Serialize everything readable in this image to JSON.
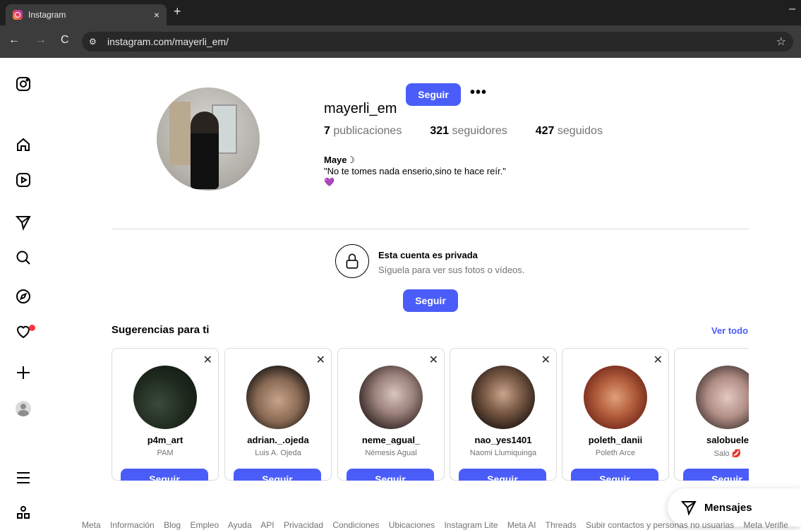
{
  "browser": {
    "tab_title": "Instagram",
    "tab_close": "×",
    "new_tab": "+",
    "minimize": "–",
    "back": "←",
    "forward": "→",
    "reload": "C",
    "url": "instagram.com/mayerli_em/"
  },
  "profile": {
    "username": "mayerli_em",
    "follow_label": "Seguir",
    "more": "•••",
    "posts_count": "7",
    "posts_label": "publicaciones",
    "followers_count": "321",
    "followers_label": "seguidores",
    "following_count": "427",
    "following_label": "seguidos",
    "bio_name": "Maye☽",
    "bio_text": "\"No te tomes nada enserio,sino te hace reír.\"",
    "bio_emoji": "💜"
  },
  "private": {
    "title": "Esta cuenta es privada",
    "subtitle": "Síguela para ver sus fotos o vídeos.",
    "follow_label": "Seguir"
  },
  "suggestions": {
    "title": "Sugerencias para ti",
    "see_all": "Ver todo",
    "close": "✕",
    "items": [
      {
        "username": "p4m_art",
        "name": "PAM",
        "button": "Seguir"
      },
      {
        "username": "adrian._.ojeda",
        "name": "Luis A. Ojeda",
        "button": "Seguir"
      },
      {
        "username": "neme_agual_",
        "name": "Némesis Agual",
        "button": "Seguir"
      },
      {
        "username": "nao_yes1401",
        "name": "Naomi Llumiquinga",
        "button": "Seguir"
      },
      {
        "username": "poleth_danii",
        "name": "Poleth Arce",
        "button": "Seguir"
      },
      {
        "username": "salobuele",
        "name": "Salo 💋",
        "button": "Seguir"
      }
    ]
  },
  "messages": {
    "label": "Mensajes"
  },
  "footer": [
    "Meta",
    "Información",
    "Blog",
    "Empleo",
    "Ayuda",
    "API",
    "Privacidad",
    "Condiciones",
    "Ubicaciones",
    "Instagram Lite",
    "Meta AI",
    "Threads",
    "Subir contactos y personas no usuarias",
    "Meta Verified"
  ],
  "colors": {
    "accent": "#4a5df9",
    "notification": "#ff3040"
  }
}
